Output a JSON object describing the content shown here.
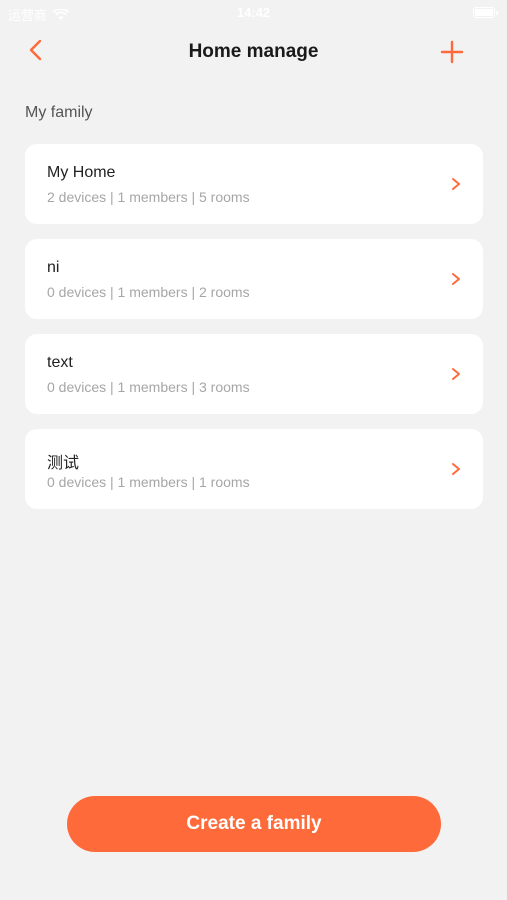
{
  "status_bar": {
    "carrier": "运营商",
    "time": "14:42",
    "icons": [
      "wifi-icon",
      "battery-icon"
    ]
  },
  "header": {
    "title": "Home manage",
    "back_icon": "chevron-left-icon",
    "add_icon": "plus-icon"
  },
  "section": {
    "label": "My family"
  },
  "families": [
    {
      "name": "My Home",
      "summary": "2 devices | 1 members | 5 rooms"
    },
    {
      "name": "ni",
      "summary": "0 devices | 1 members | 2 rooms"
    },
    {
      "name": "text",
      "summary": "0 devices | 1 members | 3 rooms"
    },
    {
      "name": "测试",
      "summary": "0 devices | 1 members | 1 rooms"
    }
  ],
  "actions": {
    "create_label": "Create a family"
  },
  "colors": {
    "accent": "#ff6a3a",
    "background": "#f2f2f2",
    "card": "#ffffff",
    "secondary_text": "#a6a6a6"
  }
}
